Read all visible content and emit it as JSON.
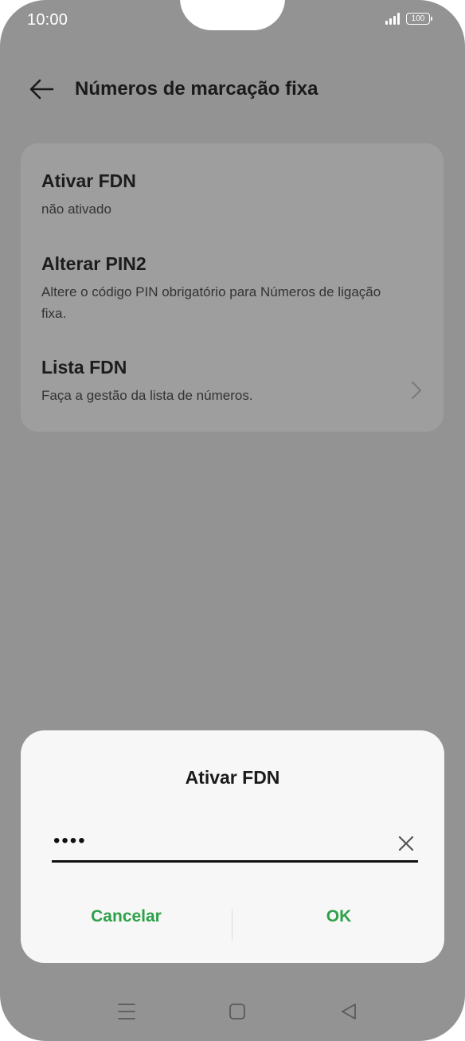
{
  "status_bar": {
    "time": "10:00",
    "battery": "100",
    "signal_icon": "signal-icon",
    "battery_icon": "battery-icon"
  },
  "header": {
    "title": "Números de marcação fixa",
    "back_icon": "arrow-left-icon"
  },
  "settings": {
    "items": [
      {
        "title": "Ativar FDN",
        "subtitle": "não ativado"
      },
      {
        "title": "Alterar PIN2",
        "subtitle": "Altere o código PIN obrigatório para Números de ligação fixa."
      },
      {
        "title": "Lista FDN",
        "subtitle": "Faça a gestão da lista de números."
      }
    ]
  },
  "dialog": {
    "title": "Ativar FDN",
    "input_value": "••••",
    "cancel_label": "Cancelar",
    "ok_label": "OK",
    "accent_color": "#2ea14a"
  },
  "nav_bar": {
    "icons": [
      "menu-icon",
      "home-icon",
      "back-triangle-icon"
    ]
  }
}
